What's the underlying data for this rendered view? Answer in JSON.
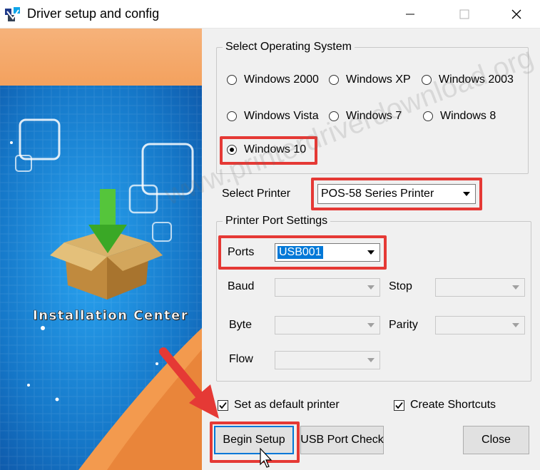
{
  "window": {
    "title": "Driver setup and config"
  },
  "banner": {
    "caption": "Installation Center"
  },
  "os_group": {
    "legend": "Select Operating System",
    "options": [
      {
        "label": "Windows 2000",
        "checked": false
      },
      {
        "label": "Windows XP",
        "checked": false
      },
      {
        "label": "Windows 2003",
        "checked": false
      },
      {
        "label": "Windows Vista",
        "checked": false
      },
      {
        "label": "Windows 7",
        "checked": false
      },
      {
        "label": "Windows 8",
        "checked": false
      },
      {
        "label": "Windows 10",
        "checked": true
      }
    ]
  },
  "printer": {
    "label": "Select Printer",
    "value": "POS-58 Series Printer"
  },
  "port_group": {
    "legend": "Printer Port Settings",
    "ports_label": "Ports",
    "ports_value": "USB001",
    "baud_label": "Baud",
    "stop_label": "Stop",
    "byte_label": "Byte",
    "parity_label": "Parity",
    "flow_label": "Flow"
  },
  "options": {
    "default_printer_label": "Set as default printer",
    "default_printer_checked": true,
    "shortcuts_label": "Create Shortcuts",
    "shortcuts_checked": true
  },
  "buttons": {
    "begin_setup": "Begin Setup",
    "usb_check": "USB Port Check",
    "close": "Close"
  },
  "watermark": {
    "text": "www.printerdriverdownload.org"
  },
  "colors": {
    "highlight": "#e53935",
    "banner_orange": "#f4a460",
    "banner_blue": "#1a7fd4",
    "selection": "#0078d7"
  }
}
